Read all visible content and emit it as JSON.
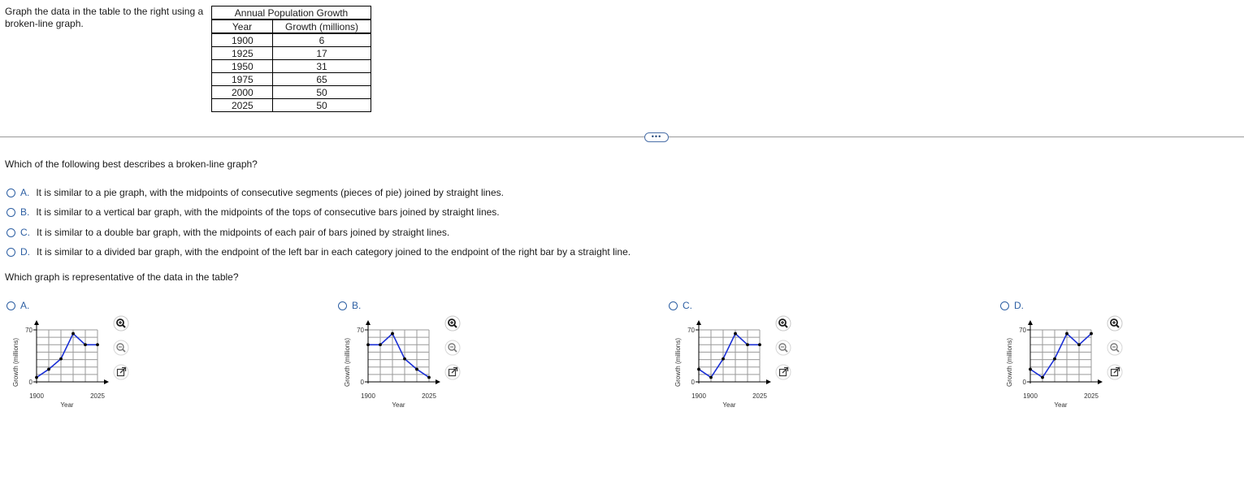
{
  "prompt": "Graph the data in the table to the right using a broken-line graph.",
  "table": {
    "caption": "Annual Population Growth",
    "headers": [
      "Year",
      "Growth (millions)"
    ],
    "rows": [
      [
        "1900",
        "6"
      ],
      [
        "1925",
        "17"
      ],
      [
        "1950",
        "31"
      ],
      [
        "1975",
        "65"
      ],
      [
        "2000",
        "50"
      ],
      [
        "2025",
        "50"
      ]
    ]
  },
  "more_button": "•••",
  "question1": {
    "text": "Which of the following best describes a broken-line graph?",
    "options": [
      {
        "letter": "A.",
        "text": "It is similar to a pie graph, with the midpoints of consecutive segments (pieces of pie) joined by straight lines."
      },
      {
        "letter": "B.",
        "text": "It is similar to a vertical bar graph, with the midpoints of the tops of consecutive bars joined by straight lines."
      },
      {
        "letter": "C.",
        "text": "It is similar to a double bar graph, with the midpoints of each pair of bars joined by straight lines."
      },
      {
        "letter": "D.",
        "text": "It is similar to a divided bar graph, with the endpoint of the left bar in each category joined to the endpoint of the right bar by a straight line."
      }
    ]
  },
  "question2": {
    "text": "Which graph is representative of the data in the table?",
    "graph_labels": {
      "ylabel": "Growth (millions)",
      "xlabel": "Year",
      "ytick_top": "70",
      "ytick_bottom": "0",
      "xtick_left": "1900",
      "xtick_right": "2025"
    }
  },
  "colors": {
    "accent": "#2d5fa3",
    "series": "#1a2fd6"
  },
  "chart_data": [
    {
      "option": "A.",
      "type": "line",
      "x": [
        1900,
        1925,
        1950,
        1975,
        2000,
        2025
      ],
      "y": [
        6,
        17,
        31,
        65,
        50,
        50
      ],
      "xlim": [
        1900,
        2025
      ],
      "ylim": [
        0,
        70
      ],
      "xlabel": "Year",
      "ylabel": "Growth (millions)",
      "grid": true
    },
    {
      "option": "B.",
      "type": "line",
      "x": [
        1900,
        1925,
        1950,
        1975,
        2000,
        2025
      ],
      "y": [
        50,
        50,
        65,
        31,
        17,
        6
      ],
      "xlim": [
        1900,
        2025
      ],
      "ylim": [
        0,
        70
      ],
      "xlabel": "Year",
      "ylabel": "Growth (millions)",
      "grid": true
    },
    {
      "option": "C.",
      "type": "line",
      "x": [
        1900,
        1925,
        1950,
        1975,
        2000,
        2025
      ],
      "y": [
        17,
        6,
        31,
        65,
        50,
        50
      ],
      "xlim": [
        1900,
        2025
      ],
      "ylim": [
        0,
        70
      ],
      "xlabel": "Year",
      "ylabel": "Growth (millions)",
      "grid": true
    },
    {
      "option": "D.",
      "type": "line",
      "x": [
        1900,
        1925,
        1950,
        1975,
        2000,
        2025
      ],
      "y": [
        17,
        6,
        31,
        65,
        50,
        65
      ],
      "xlim": [
        1900,
        2025
      ],
      "ylim": [
        0,
        70
      ],
      "xlabel": "Year",
      "ylabel": "Growth (millions)",
      "grid": true
    }
  ]
}
